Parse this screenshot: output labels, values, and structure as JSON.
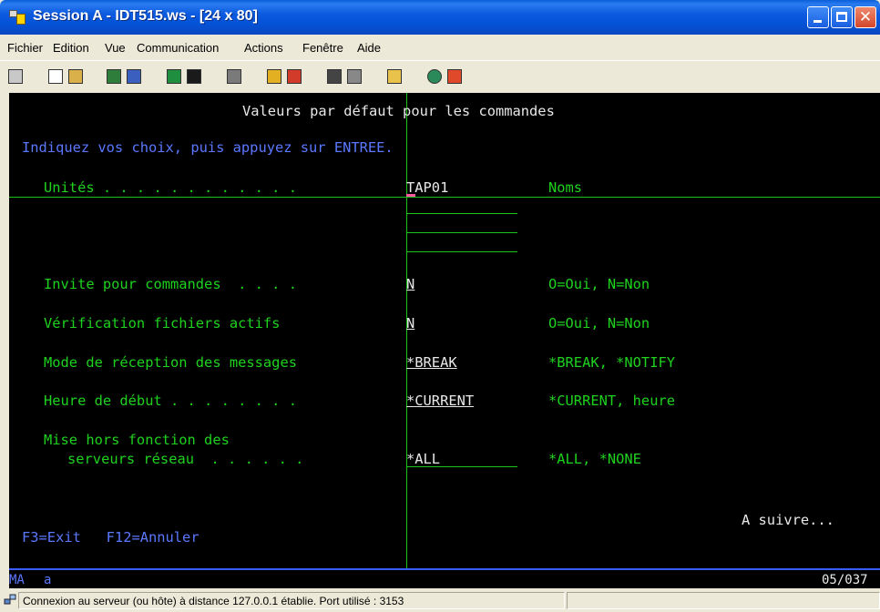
{
  "window": {
    "title": "Session A - IDT515.ws - [24 x 80]",
    "minimize_icon": "minimize-icon",
    "maximize_icon": "maximize-icon",
    "close_icon": "close-icon"
  },
  "menu": {
    "items": [
      "Fichier",
      "Edition",
      "Vue",
      "Communication",
      "Actions",
      "Fenêtre",
      "Aide"
    ]
  },
  "toolbar": {
    "icons": [
      "print-screen-icon",
      "copy-icon",
      "paste-icon",
      "send-file-icon",
      "receive-file-icon",
      "display-icon",
      "keyboard-icon",
      "macro-icon",
      "play-macro-icon",
      "record-macro-icon",
      "stop-macro-icon",
      "start-macro-icon",
      "clipboard-icon",
      "globe-icon",
      "edit-icon"
    ]
  },
  "screen": {
    "title": "Valeurs par défaut pour les commandes",
    "instruction": "Indiquez vos choix, puis appuyez sur ENTREE.",
    "fields": {
      "units_label": "Unités . . . . . . . . . . . .",
      "units_value": "TAP01",
      "units_hint": "Noms",
      "prompt_label": "Invite pour commandes  . . . .",
      "prompt_value": "N",
      "prompt_hint": "O=Oui, N=Non",
      "verify_label": "Vérification fichiers actifs",
      "verify_value": "N",
      "verify_hint": "O=Oui, N=Non",
      "msgmode_label": "Mode de réception des messages",
      "msgmode_value": "*BREAK",
      "msgmode_hint": "*BREAK, *NOTIFY",
      "start_label": "Heure de début . . . . . . . .",
      "start_value": "*CURRENT",
      "start_hint": "*CURRENT, heure",
      "vary_label_1": "Mise hors fonction des",
      "vary_label_2": "serveurs réseau  . . . . . .",
      "vary_value": "*ALL",
      "vary_hint": "*ALL, *NONE"
    },
    "more": "A suivre...",
    "fkeys": "F3=Exit   F12=Annuler"
  },
  "oia": {
    "mode": "MA",
    "input": "a",
    "position": "05/037"
  },
  "status": {
    "message": "Connexion au serveur (ou hôte) à distance 127.0.0.1 établie. Port utilisé : 3153"
  }
}
